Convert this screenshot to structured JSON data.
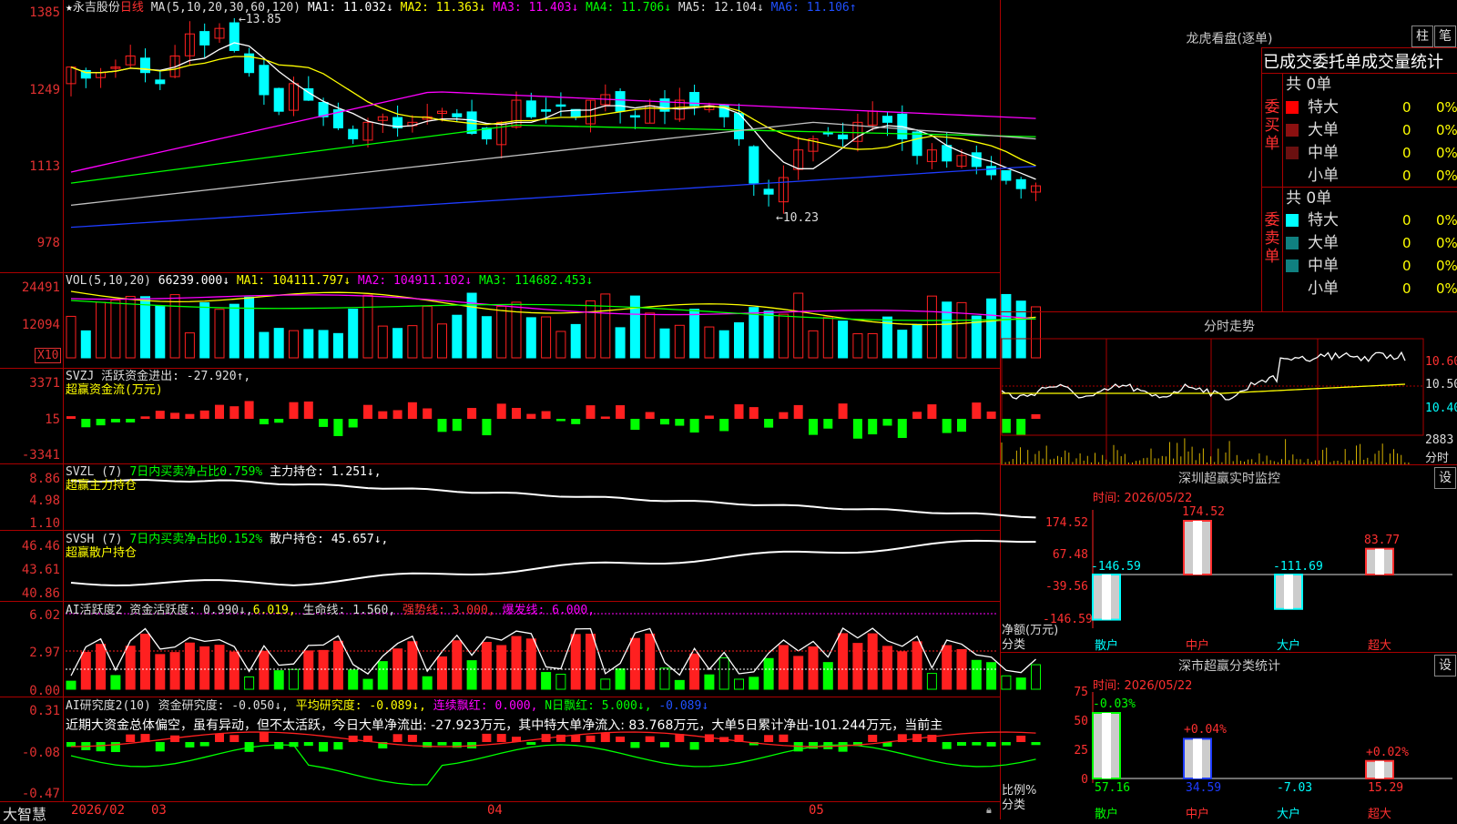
{
  "colors": {
    "up": "#ff2020",
    "down": "#00ffff",
    "green": "#00ff00",
    "yellow": "#ffff00",
    "magenta": "#ff00ff",
    "white": "#ffffff",
    "blue": "#1e3cff",
    "grid": "#aa0000"
  },
  "kline": {
    "stock_name": "永吉股份",
    "period": "日线",
    "ma_head": "MA(5,10,20,30,60,120)",
    "ma1": "MA1: 11.032↓",
    "ma2": "MA2: 11.363↓",
    "ma3": "MA3: 11.403↓",
    "ma4": "MA4: 11.706↓",
    "ma5": "MA5: 12.104↓",
    "ma6": "MA6: 11.106↑",
    "high_tag": "←13.85",
    "low_tag": "←10.23",
    "ticks": [
      "1385",
      "1249",
      "1113",
      "978"
    ]
  },
  "vol": {
    "head": "VOL(5,10,20)",
    "value": "66239.000↓",
    "ma1": "MA1: 104111.797↓",
    "ma2": "MA2: 104911.102↓",
    "ma3": "MA3: 114682.453↓",
    "ticks": [
      "24491",
      "12094"
    ],
    "unit": "X10"
  },
  "svzj": {
    "head": "SVZJ  活跃资金进出: -27.920↑,",
    "sub": "超赢资金流(万元)",
    "ticks": [
      "3371",
      "15",
      "-3341"
    ]
  },
  "svzl": {
    "head_a": "SVZL (7) ",
    "head_b": "7日内买卖净占比0.759%",
    "head_c": " 主力持仓: 1.251↓,",
    "sub": "超赢主力持仓",
    "ticks": [
      "8.86",
      "4.98",
      "1.10"
    ]
  },
  "svsh": {
    "head_a": "SVSH (7) ",
    "head_b": "7日内买卖净占比0.152%",
    "head_c": " 散户持仓: 45.657↓,",
    "sub": "超赢散户持仓",
    "ticks": [
      "46.46",
      "43.61",
      "40.86"
    ]
  },
  "ai_active": {
    "head_a": "AI活跃度2 资金活跃度: 0.990↓,",
    "head_b": "6.019,",
    "head_c": " 生命线: 1.560,",
    "head_d": " 强势线: 3.000,",
    "head_e": " 爆发线: 6.000,",
    "ticks": [
      "6.02",
      "2.97",
      "0.00"
    ]
  },
  "ai_research": {
    "head_a": "AI研究度2(10) 资金研究度: -0.050↓,",
    "head_b": " 平均研究度: -0.089↓,",
    "head_c": " 连续飘红: 0.000,",
    "head_d": " N日飘红: 5.000↓,",
    "head_e": " -0.089↓",
    "comment": "近期大资金总体偏空，虽有异动，但不太活跃，今日大单净流出: -27.923万元，其中特大单净流入: 83.768万元，大单5日累计净出-101.244万元，当前主",
    "ticks": [
      "0.31",
      "-0.08",
      "-0.47"
    ]
  },
  "xaxis": {
    "brand": "大智慧",
    "labels": [
      "2026/02",
      "03",
      "04",
      "05"
    ]
  },
  "dragon": {
    "title": "龙虎看盘(逐单)",
    "btn1": "柱",
    "btn2": "笔",
    "sub": "已成交委托单成交量统计",
    "buy_label": "委买单",
    "sell_label": "委卖单",
    "buy_total": "共 0单",
    "sell_total": "共 0单",
    "rows": [
      {
        "name": "特大",
        "v": "0",
        "p": "0%"
      },
      {
        "name": "大单",
        "v": "0",
        "p": "0%"
      },
      {
        "name": "中单",
        "v": "0",
        "p": "0%"
      },
      {
        "name": "小单",
        "v": "0",
        "p": "0%"
      }
    ]
  },
  "intraday": {
    "title": "分时走势",
    "ticks": [
      "10.60",
      "10.50",
      "10.40"
    ],
    "vol_tick": "2883",
    "vol_unit": "分时"
  },
  "monitor": {
    "title": "深圳超赢实时监控",
    "btn": "设",
    "time": "时间: 2026/05/22",
    "ticks": [
      "174.52",
      "67.48",
      "-39.56",
      "-146.59"
    ],
    "ylab1": "净额(万元)",
    "ylab2": "分类",
    "bars": [
      {
        "cat": "散户",
        "value": -146.59,
        "label": "-146.59"
      },
      {
        "cat": "中户",
        "value": 174.52,
        "label": "174.52"
      },
      {
        "cat": "大户",
        "value": -111.69,
        "label": "-111.69"
      },
      {
        "cat": "超大",
        "value": 83.77,
        "label": "83.77"
      }
    ]
  },
  "classify": {
    "title": "深市超赢分类统计",
    "btn": "设",
    "time": "时间: 2026/05/22",
    "ticks": [
      "75",
      "50",
      "25",
      "0"
    ],
    "ylab1": "比例%",
    "ylab2": "分类",
    "bars": [
      {
        "cat": "散户",
        "value": 57.16,
        "label": "57.16",
        "chg": "-0.03%"
      },
      {
        "cat": "中户",
        "value": 34.59,
        "label": "34.59",
        "chg": "+0.04%"
      },
      {
        "cat": "大户",
        "value": -7.03,
        "label": "-7.03",
        "chg": ""
      },
      {
        "cat": "超大",
        "value": 15.29,
        "label": "15.29",
        "chg": "+0.02%"
      }
    ]
  }
}
